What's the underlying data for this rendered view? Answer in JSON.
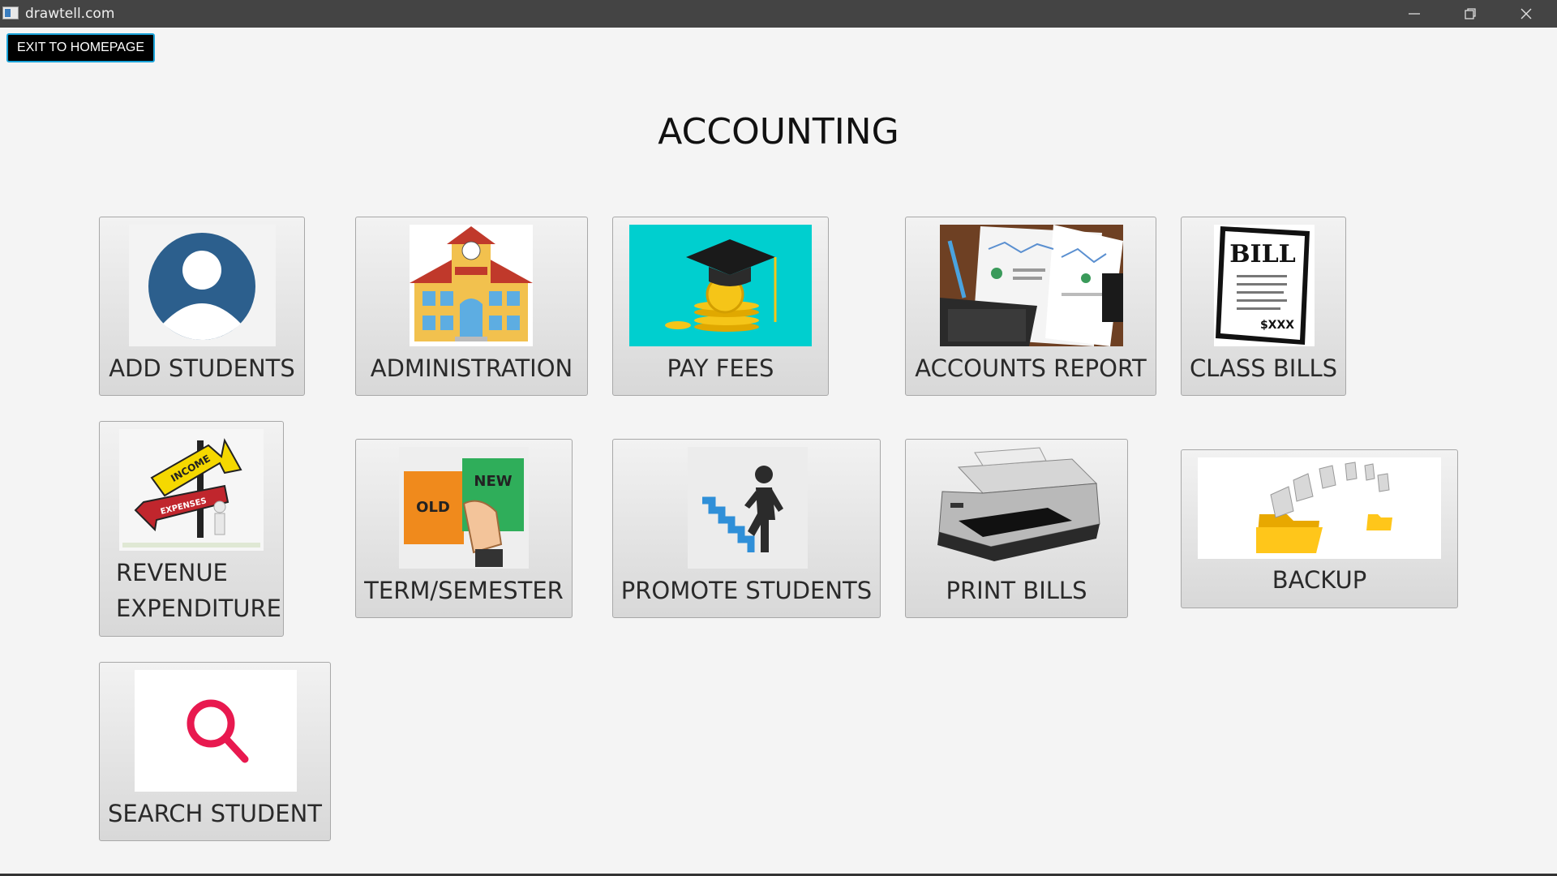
{
  "window": {
    "title": "drawtell.com"
  },
  "toolbar": {
    "exit_label": "EXIT TO HOMEPAGE"
  },
  "page": {
    "title": "ACCOUNTING"
  },
  "tiles": {
    "add_students": {
      "label": "ADD STUDENTS",
      "icon": "user-avatar-icon"
    },
    "administration": {
      "label": "ADMINISTRATION",
      "icon": "school-building-icon"
    },
    "pay_fees": {
      "label": "PAY FEES",
      "icon": "graduation-cap-coins-icon"
    },
    "accounts_report": {
      "label": "ACCOUNTS REPORT",
      "icon": "report-documents-icon"
    },
    "class_bills": {
      "label": "CLASS BILLS",
      "icon": "bill-paper-icon",
      "image_text": "BILL",
      "image_amount": "$XXX"
    },
    "revenue_expenditure": {
      "label_line1": "REVENUE",
      "label_line2": "EXPENDITURE",
      "icon": "income-expenses-signpost-icon",
      "sign_top": "INCOME",
      "sign_bottom": "EXPENSES"
    },
    "term_semester": {
      "label": "TERM/SEMESTER",
      "icon": "old-new-book-icon",
      "page_left": "OLD",
      "page_right": "NEW"
    },
    "promote_students": {
      "label": "PROMOTE STUDENTS",
      "icon": "climbing-stairs-icon"
    },
    "print_bills": {
      "label": "PRINT BILLS",
      "icon": "printer-icon"
    },
    "backup": {
      "label": "BACKUP",
      "icon": "folder-backup-icon"
    },
    "search_student": {
      "label": "SEARCH STUDENT",
      "icon": "search-icon"
    }
  },
  "colors": {
    "titlebar": "#444444",
    "background": "#f4f4f4",
    "exit_border": "#1aa3d9",
    "avatar": "#2c5f8d",
    "pay_fees_bg": "#00cfcf",
    "search_icon": "#e8194f"
  }
}
